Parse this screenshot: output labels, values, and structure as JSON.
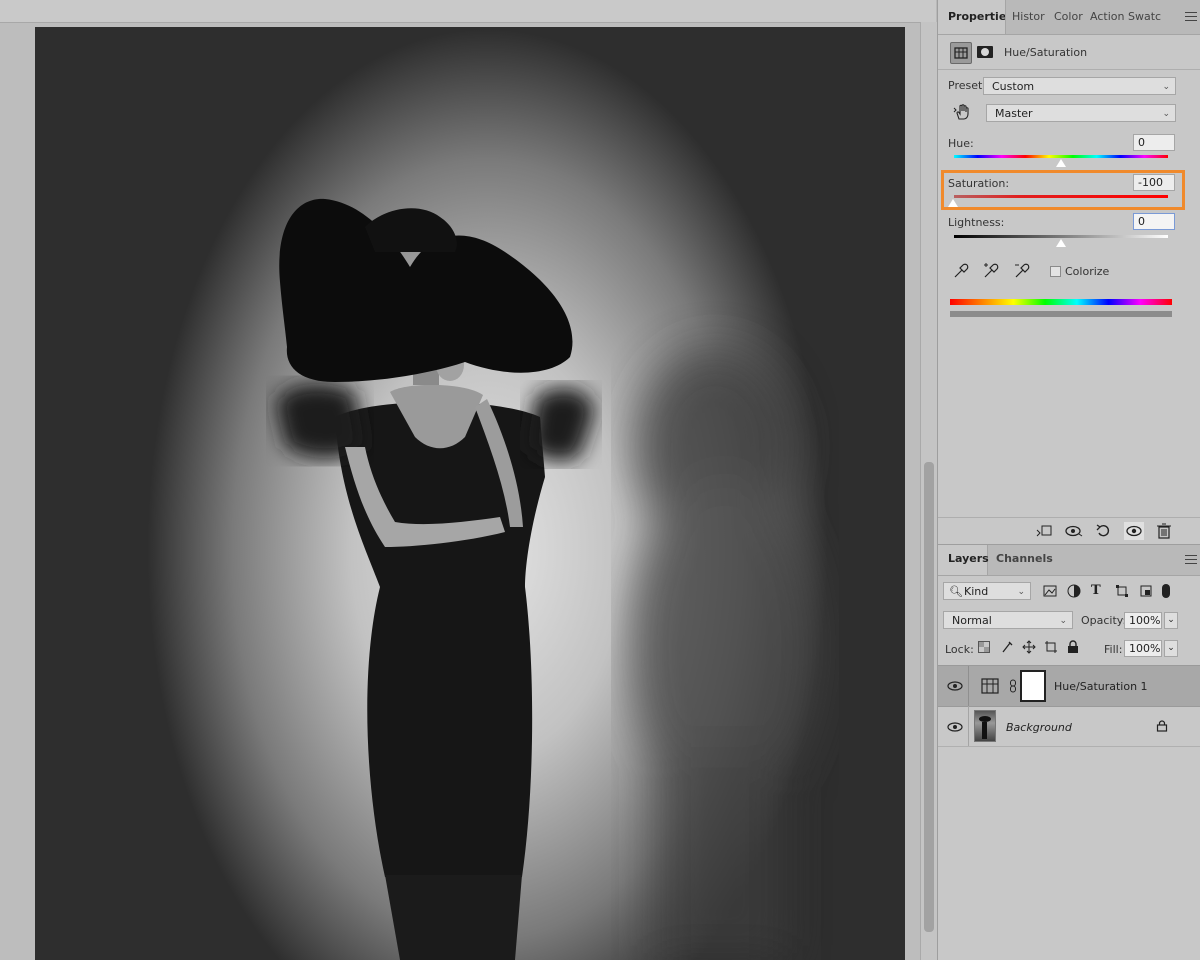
{
  "document_canvas": {
    "image": "black-and-white portrait of a woman in a wide-brim black hat and fitted black dress against a grey wall with her shadow"
  },
  "properties_panel": {
    "tabs": [
      {
        "label": "Properties",
        "active": true
      },
      {
        "label": "Histor",
        "active": false
      },
      {
        "label": "Color",
        "active": false
      },
      {
        "label": "Action",
        "active": false
      },
      {
        "label": "Swatcl",
        "active": false
      }
    ],
    "adjustment_title": "Hue/Saturation",
    "preset_label": "Preset:",
    "preset_value": "Custom",
    "channel_value": "Master",
    "hue_label": "Hue:",
    "hue_value": "0",
    "saturation_label": "Saturation:",
    "saturation_value": "-100",
    "lightness_label": "Lightness:",
    "lightness_value": "0",
    "colorize_label": "Colorize",
    "colorize_checked": false,
    "highlight_color": "#f08a2c"
  },
  "layers_panel": {
    "tabs": [
      {
        "label": "Layers",
        "active": true
      },
      {
        "label": "Channels",
        "active": false
      }
    ],
    "filter_kind": "Kind",
    "blend_mode": "Normal",
    "opacity_label": "Opacity:",
    "opacity_value": "100%",
    "lock_label": "Lock:",
    "fill_label": "Fill:",
    "fill_value": "100%",
    "layers": [
      {
        "name": "Hue/Saturation 1",
        "selected": true,
        "visible": true
      },
      {
        "name": "Background",
        "selected": false,
        "visible": true,
        "locked": true
      }
    ]
  }
}
